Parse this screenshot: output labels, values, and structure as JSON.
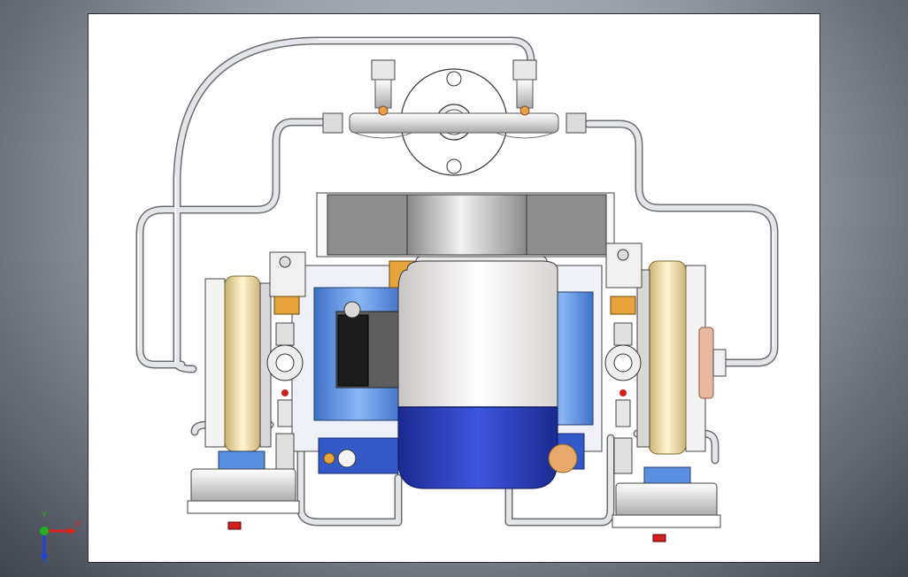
{
  "triad": {
    "x_label": "X",
    "y_label": "Y",
    "z_label": "Z",
    "x_color": "#e02020",
    "y_color": "#20b020",
    "z_color": "#2040e0"
  },
  "colors": {
    "background_light": "#c9ced6",
    "background_dark": "#3f454d",
    "sheet": "#ffffff",
    "pipe": "#d8dadd",
    "motor_body": "#f4f0ee",
    "motor_base": "#2b3fc0",
    "housing_blue": "#5a8fe0",
    "flange_cream": "#f5e6b0",
    "brass": "#e8a23c",
    "fitting_red": "#d02020",
    "copper": "#e6a080"
  }
}
